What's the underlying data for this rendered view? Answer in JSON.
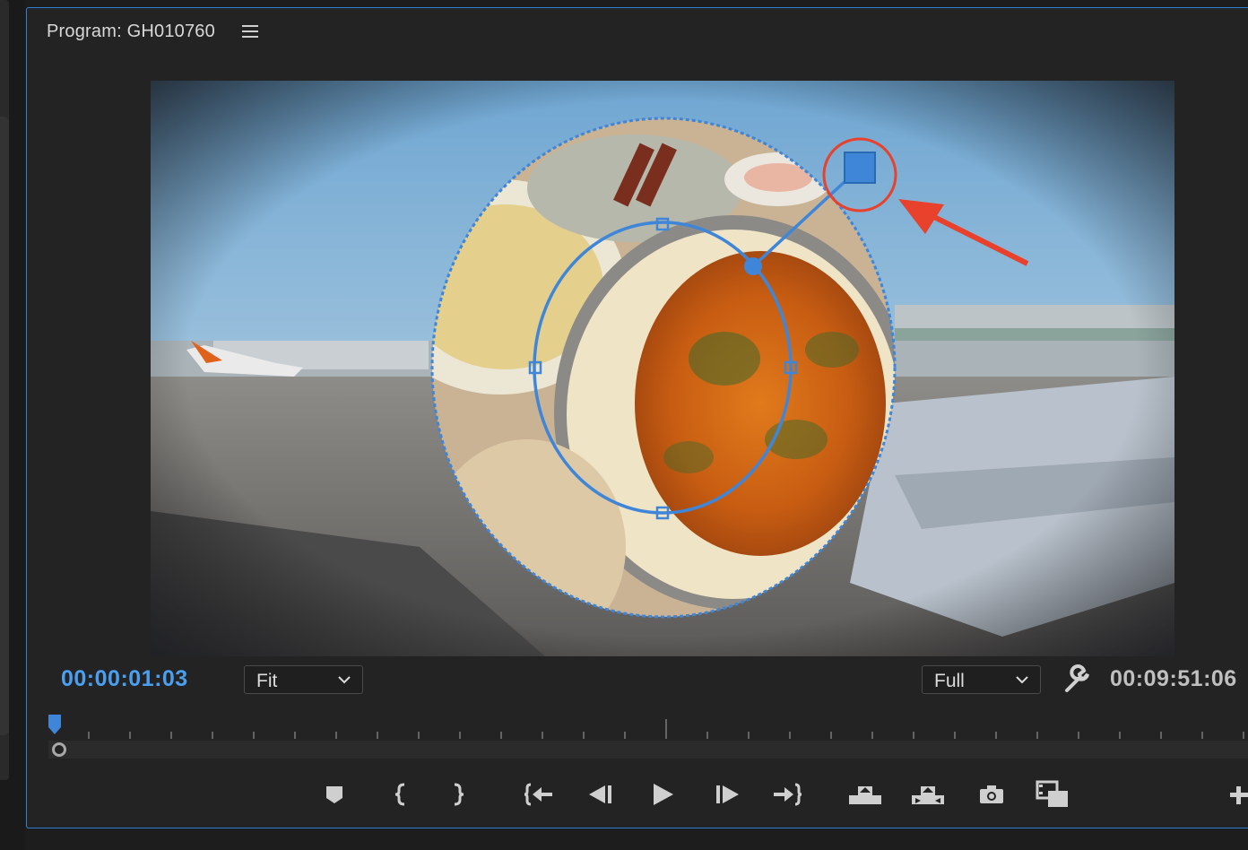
{
  "panel": {
    "title": "Program: GH010760",
    "menu_icon": "hamburger-menu-icon"
  },
  "viewer": {
    "description_icon": "mask-ellipse-overlay",
    "accent_color": "#2e80d6",
    "annotation_color": "#e8412c"
  },
  "timecode": {
    "current": "00:00:01:03",
    "duration": "00:09:51:06",
    "current_color": "#4a9ff0"
  },
  "zoom": {
    "selected": "Fit"
  },
  "resolution": {
    "selected": "Full"
  },
  "transport": {
    "buttons": [
      {
        "name": "add-marker-button",
        "icon": "marker-icon"
      },
      {
        "name": "mark-in-button",
        "icon": "mark-in-icon"
      },
      {
        "name": "mark-out-button",
        "icon": "mark-out-icon"
      },
      {
        "name": "go-to-in-button",
        "icon": "go-to-in-icon"
      },
      {
        "name": "step-back-button",
        "icon": "step-back-icon"
      },
      {
        "name": "play-button",
        "icon": "play-icon"
      },
      {
        "name": "step-forward-button",
        "icon": "step-forward-icon"
      },
      {
        "name": "go-to-out-button",
        "icon": "go-to-out-icon"
      },
      {
        "name": "lift-button",
        "icon": "lift-icon"
      },
      {
        "name": "extract-button",
        "icon": "extract-icon"
      },
      {
        "name": "export-frame-button",
        "icon": "camera-icon"
      },
      {
        "name": "comparison-view-button",
        "icon": "comparison-view-icon"
      },
      {
        "name": "add-button",
        "icon": "plus-icon"
      }
    ]
  }
}
